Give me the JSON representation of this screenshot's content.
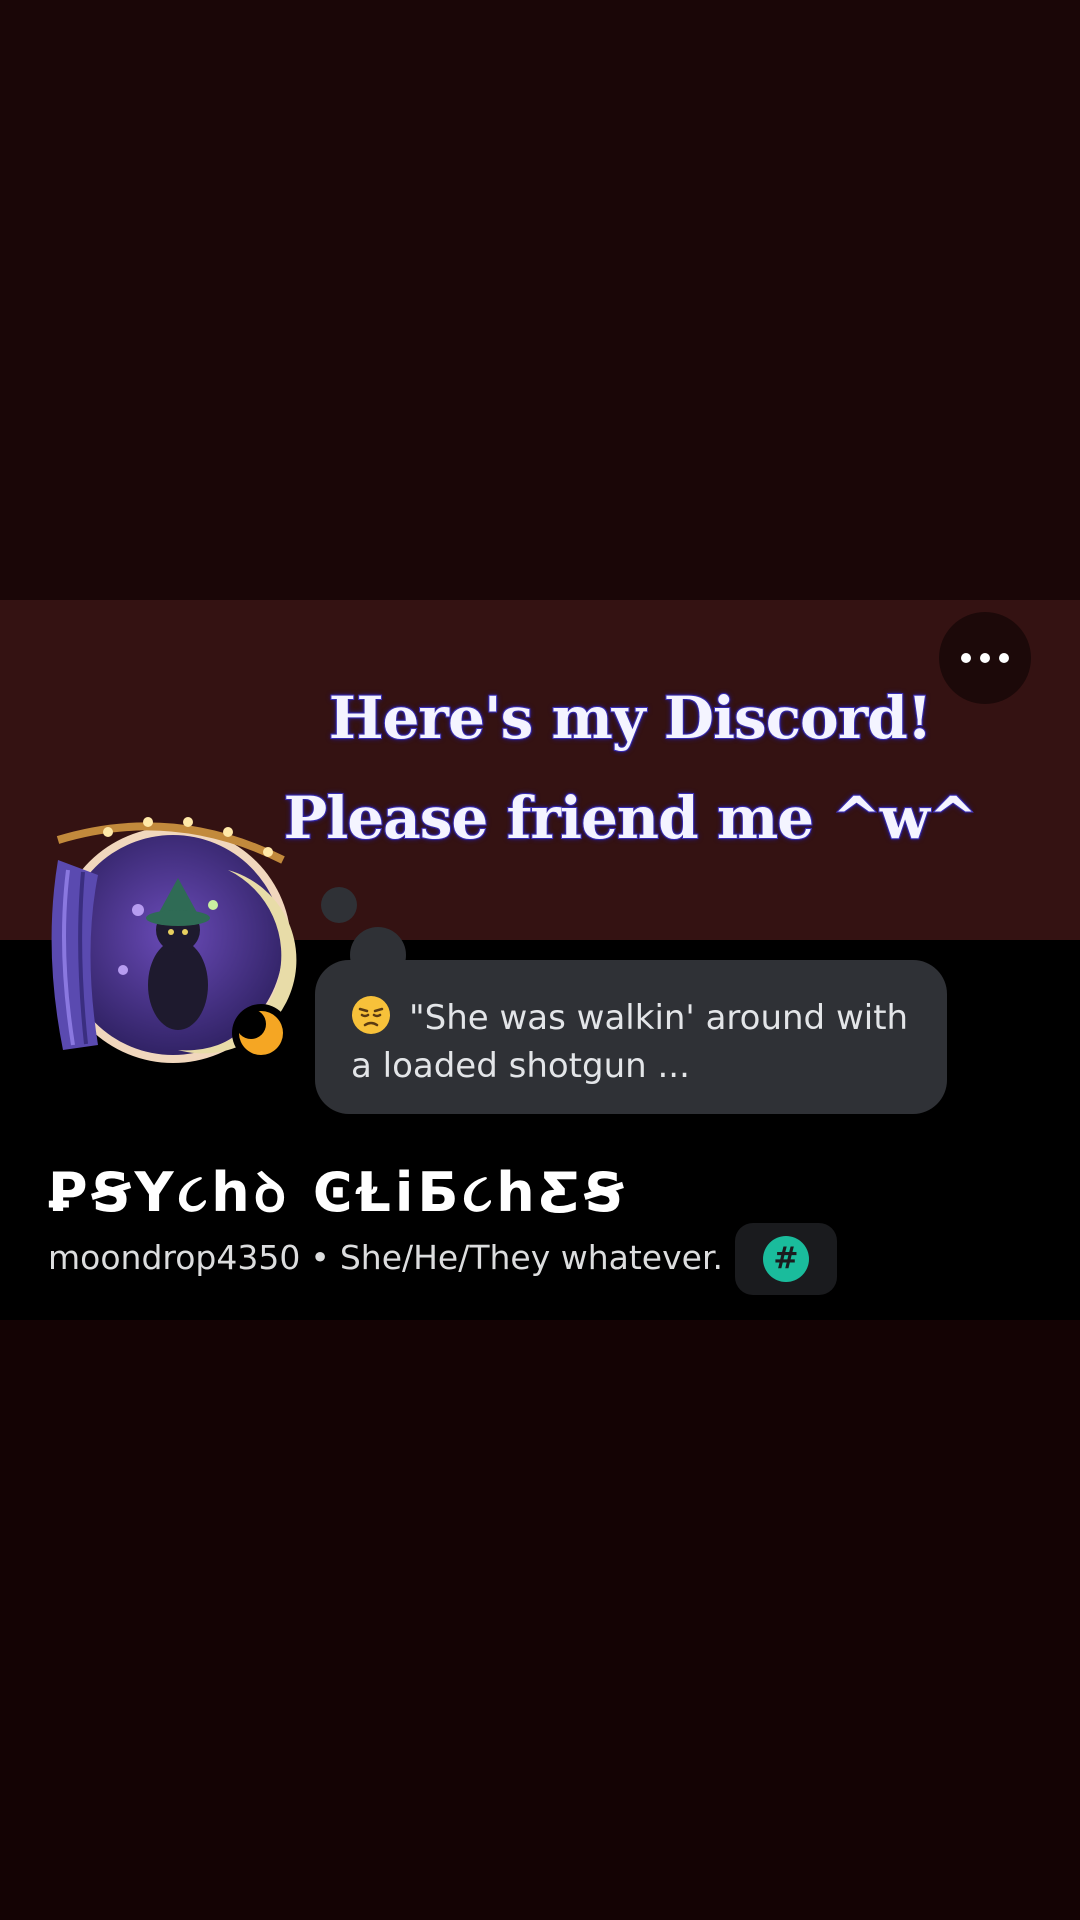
{
  "overlay": {
    "caption_line1": "Here's my Discord!",
    "caption_line2": "Please friend me ^w^"
  },
  "header": {
    "more_icon": "ellipsis-icon"
  },
  "profile": {
    "avatar_icon": "witch-cat-moon-avatar",
    "presence_icon": "idle-moon-icon",
    "status": {
      "emoji_icon": "persevering-face-emoji",
      "text": "\"She was walkin' around with a loaded shotgun ..."
    },
    "display_name": "ꝐꞨY૮hꝺ ϾⱢiƂ૮hƸꞨ",
    "username": "moondrop4350",
    "separator": "•",
    "pronouns": "She/He/They whatever.",
    "badge_icon": "hashtag-badge-icon",
    "badge_symbol": "#"
  },
  "colors": {
    "banner": "#341212",
    "panel": "#000000",
    "bubble": "#2f3136",
    "badge_accent": "#1abc9c",
    "idle_moon": "#f5a623"
  }
}
